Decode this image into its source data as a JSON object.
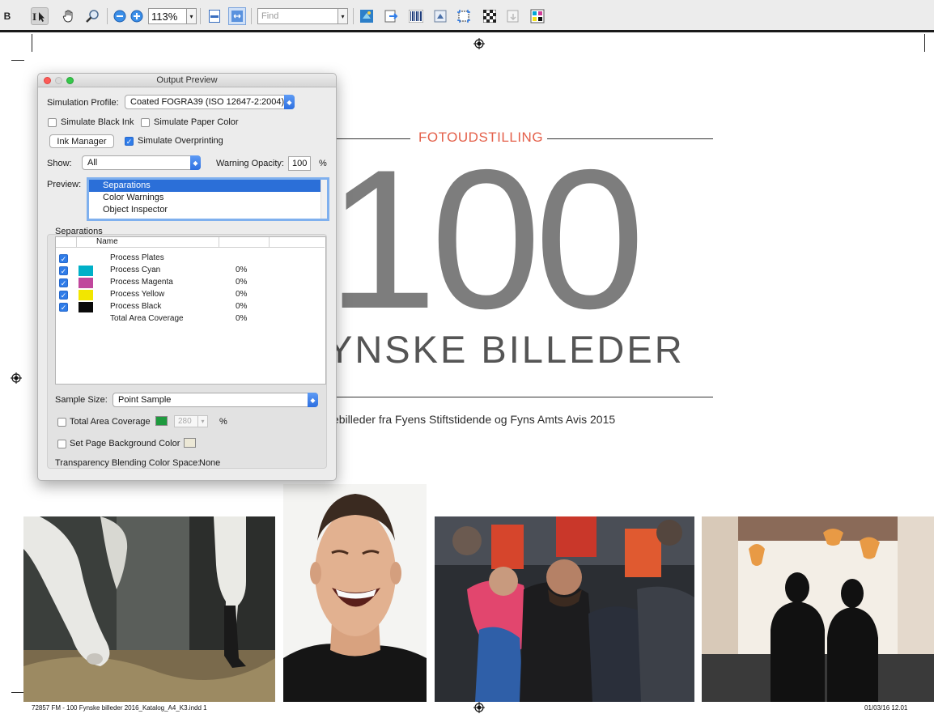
{
  "toolbar": {
    "partial_label": "B",
    "zoom_value": "113%",
    "find_placeholder": "Find",
    "dropdown_glyph": "▾",
    "tools_left": [
      "select-text-icon",
      "hand-icon",
      "zoom-icon"
    ],
    "tools_right": [
      "preflight-icon",
      "export-icon",
      "barcode-icon",
      "flatten-icon",
      "crop-icon",
      "checker-icon",
      "overlay-icon",
      "output-preview-icon"
    ]
  },
  "panel": {
    "title": "Output Preview",
    "simulation_profile_label": "Simulation Profile:",
    "simulation_profile_value": "Coated FOGRA39 (ISO 12647-2:2004)",
    "simulate_black_ink_label": "Simulate Black Ink",
    "simulate_black_ink_checked": false,
    "simulate_paper_color_label": "Simulate Paper Color",
    "simulate_paper_color_checked": false,
    "ink_manager_label": "Ink Manager",
    "simulate_overprinting_label": "Simulate Overprinting",
    "simulate_overprinting_checked": true,
    "show_label": "Show:",
    "show_value": "All",
    "warning_opacity_label": "Warning Opacity:",
    "warning_opacity_value": "100",
    "warning_opacity_unit": "%",
    "preview_label": "Preview:",
    "preview_options": [
      "Separations",
      "Color Warnings",
      "Object Inspector"
    ],
    "preview_selected": "Separations",
    "separations_title": "Separations",
    "separations_header_name": "Name",
    "separations": [
      {
        "name": "Process Plates",
        "checked": true,
        "swatch": "",
        "value": ""
      },
      {
        "name": "Process Cyan",
        "checked": true,
        "swatch": "#00b0c8",
        "value": "0%"
      },
      {
        "name": "Process Magenta",
        "checked": true,
        "swatch": "#c0479c",
        "value": "0%"
      },
      {
        "name": "Process Yellow",
        "checked": true,
        "swatch": "#f2e600",
        "value": "0%"
      },
      {
        "name": "Process Black",
        "checked": true,
        "swatch": "#0a0a0a",
        "value": "0%"
      },
      {
        "name": "Total Area Coverage",
        "checked": false,
        "swatch": "",
        "value": "0%"
      }
    ],
    "sample_size_label": "Sample Size:",
    "sample_size_value": "Point Sample",
    "total_area_coverage_label": "Total Area Coverage",
    "total_area_coverage_value": "280",
    "total_area_coverage_unit": "%",
    "total_area_coverage_color": "#1e9a3e",
    "page_bg_label": "Set Page Background Color",
    "page_bg_color": "#ece8d6",
    "blending_label": "Transparency Blending Color Space:",
    "blending_value": "None"
  },
  "document": {
    "kicker": "FOTOUDSTILLING",
    "big_number": "100",
    "headline": "YNSKE BILLEDER",
    "subtitle": "sebilleder fra Fyens Stiftstidende og Fyns Amts Avis 2015",
    "kicker_color": "#e4604a",
    "photos": [
      "horse-photo",
      "laughing-man-photo",
      "refugees-embrace-photo",
      "two-silhouettes-photo"
    ],
    "slug_left": "72857 FM - 100 Fynske billeder 2016_Katalog_A4_K3.indd   1",
    "slug_right": "01/03/16   12.01"
  }
}
